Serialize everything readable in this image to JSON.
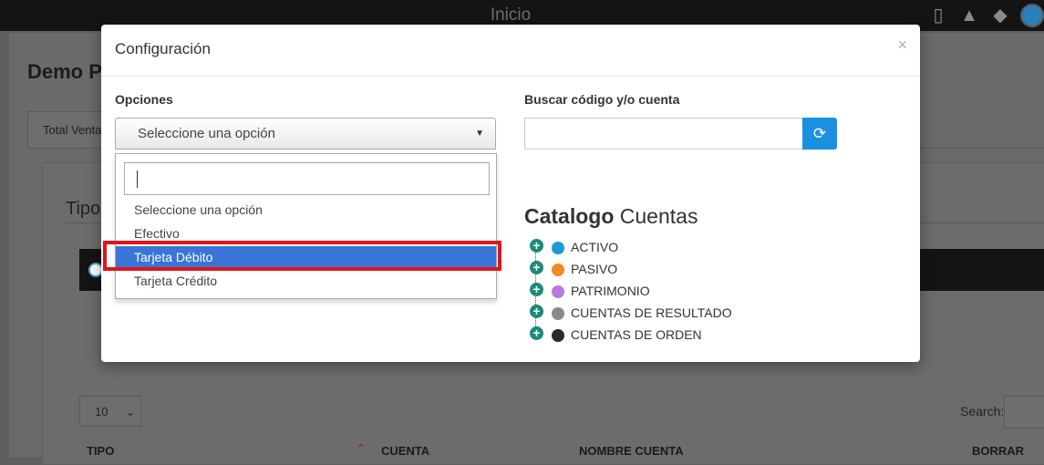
{
  "topbar": {
    "title": "Inicio",
    "icons": [
      "mobile-icon",
      "graduation-cap-icon",
      "tags-icon",
      "globe-icon"
    ]
  },
  "background": {
    "page_title": "Demo P",
    "tab_label": "Total Venta",
    "section_heading": "Tipo",
    "page_length_value": "10",
    "search_label": "Search:",
    "table_headers": [
      "TIPO",
      "CUENTA",
      "NOMBRE CUENTA",
      "BORRAR"
    ]
  },
  "modal": {
    "title": "Configuración",
    "close_label": "×",
    "options_label": "Opciones",
    "select_value": "Seleccione una opción",
    "dropdown": {
      "search_value": "",
      "options": [
        "Seleccione una opción",
        "Efectivo",
        "Tarjeta Débito",
        "Tarjeta Crédito"
      ],
      "highlighted": "Tarjeta Débito"
    },
    "search_label": "Buscar código y/o cuenta",
    "search_value": "",
    "catalog_title_bold": "Catalogo",
    "catalog_title_rest": "Cuentas",
    "tree": [
      {
        "label": "ACTIVO",
        "color": "#1b9ad6"
      },
      {
        "label": "PASIVO",
        "color": "#f08a24"
      },
      {
        "label": "PATRIMONIO",
        "color": "#b57be0"
      },
      {
        "label": "CUENTAS DE RESULTADO",
        "color": "#8a8a8a"
      },
      {
        "label": "CUENTAS DE ORDEN",
        "color": "#2b2b2b"
      }
    ]
  },
  "colors": {
    "accent": "#1b8fe0",
    "highlight": "#3875d7",
    "annotation_outline": "#e0141a",
    "tree_plus": "#1a8a7a"
  }
}
